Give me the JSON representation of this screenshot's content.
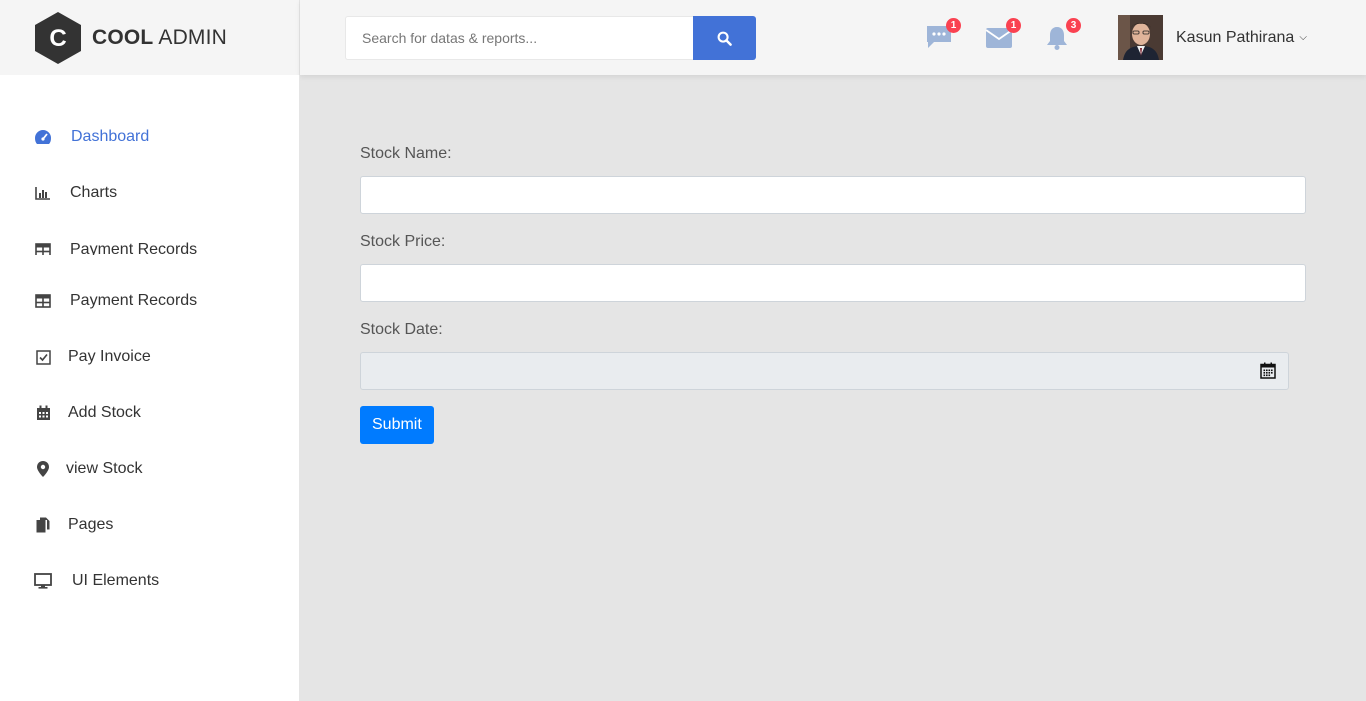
{
  "brand": {
    "bold": "COOL",
    "light": "ADMIN",
    "mark": "C"
  },
  "header": {
    "search_placeholder": "Search for datas & reports...",
    "search_icon": "search-icon",
    "notifications": [
      {
        "icon": "comment-dots-icon",
        "count": "1"
      },
      {
        "icon": "envelope-icon",
        "count": "1"
      },
      {
        "icon": "bell-icon",
        "count": "3"
      }
    ],
    "account": {
      "name": "Kasun Pathirana"
    }
  },
  "sidebar": {
    "items": [
      {
        "label": "Dashboard",
        "icon": "tachometer-icon",
        "active": true
      },
      {
        "label": "Charts",
        "icon": "bar-chart-icon"
      },
      {
        "label": "Payment Records",
        "icon": "table-icon"
      },
      {
        "label": "Payment Records",
        "icon": "table-icon"
      },
      {
        "label": "Pay Invoice",
        "icon": "check-square-icon"
      },
      {
        "label": "Add Stock",
        "icon": "calendar-icon"
      },
      {
        "label": "view Stock",
        "icon": "map-marker-icon"
      },
      {
        "label": "Pages",
        "icon": "copy-icon"
      },
      {
        "label": "UI Elements",
        "icon": "desktop-icon"
      }
    ]
  },
  "form": {
    "stock_name_label": "Stock Name:",
    "stock_name_value": "",
    "stock_price_label": "Stock Price:",
    "stock_price_value": "",
    "stock_date_label": "Stock Date:",
    "stock_date_value": "",
    "submit_label": "Submit"
  },
  "colors": {
    "accent": "#4272d7",
    "badge": "#fa4251",
    "submit": "#007bff"
  }
}
